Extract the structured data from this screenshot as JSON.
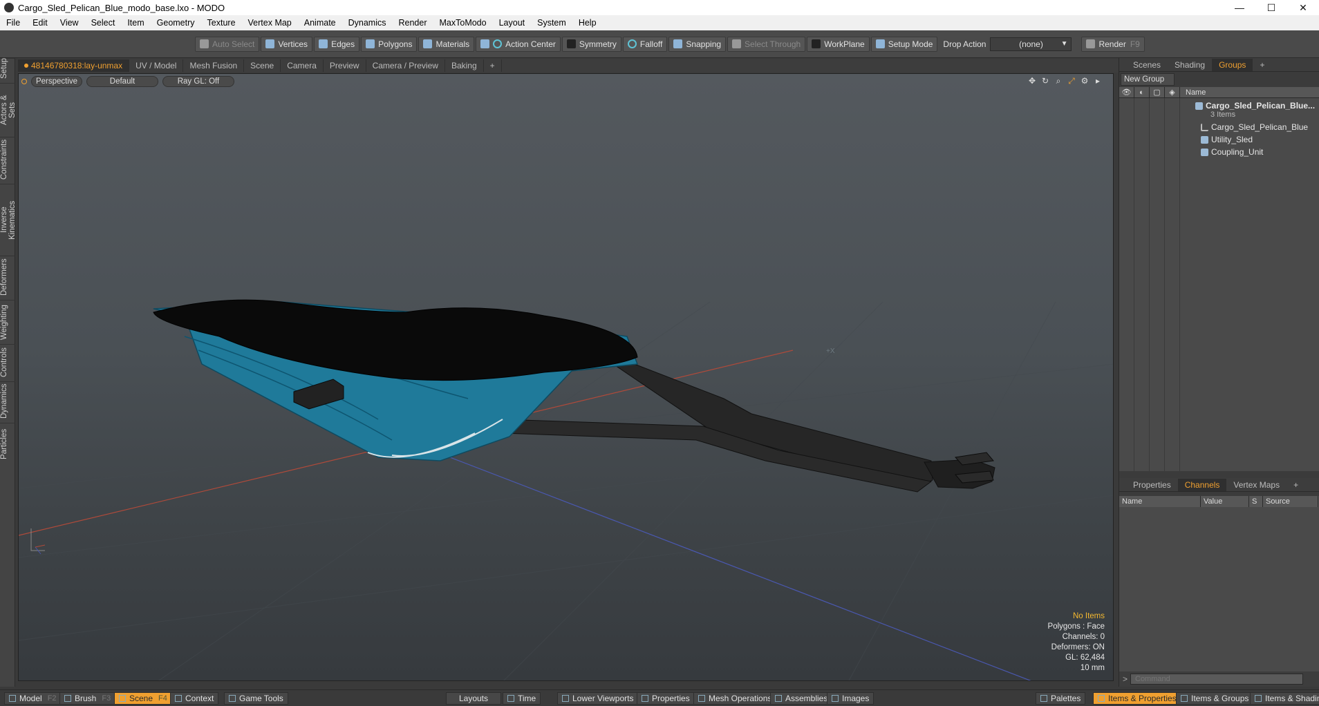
{
  "window": {
    "title": "Cargo_Sled_Pelican_Blue_modo_base.lxo - MODO",
    "minimize": "—",
    "maximize": "☐",
    "close": "✕"
  },
  "menu": [
    "File",
    "Edit",
    "View",
    "Select",
    "Item",
    "Geometry",
    "Texture",
    "Vertex Map",
    "Animate",
    "Dynamics",
    "Render",
    "MaxToModo",
    "Layout",
    "System",
    "Help"
  ],
  "toolbar": {
    "auto_select": "Auto Select",
    "vertices": "Vertices",
    "edges": "Edges",
    "polygons": "Polygons",
    "materials": "Materials",
    "action_center": "Action Center",
    "symmetry": "Symmetry",
    "falloff": "Falloff",
    "snapping": "Snapping",
    "select_through": "Select Through",
    "workplane": "WorkPlane",
    "setup_mode": "Setup Mode",
    "drop_action_label": "Drop Action",
    "drop_action_value": "(none)",
    "render": "Render",
    "render_key": "F9"
  },
  "left_rail": [
    "Setup",
    "Actors & Sets",
    "Constraints",
    "Inverse Kinematics",
    "Deformers",
    "Weighting",
    "Controls",
    "Dynamics",
    "Particles"
  ],
  "viewport_tabs": [
    "48146780318:lay-unmax",
    "UV / Model",
    "Mesh Fusion",
    "Scene",
    "Camera",
    "Preview",
    "Camera / Preview",
    "Baking",
    "+"
  ],
  "viewport": {
    "view": "Perspective",
    "style": "Default",
    "raygl": "Ray GL: Off",
    "axis_label": "+X",
    "stats": {
      "selection": "No Items",
      "polygons": "Polygons : Face",
      "channels": "Channels: 0",
      "deformers": "Deformers: ON",
      "gl": "GL: 62,484",
      "scale": "10 mm"
    },
    "colors": {
      "sled_blue": "#1f7a9a",
      "lid": "#0a0a0a",
      "frame": "#2a2a2a",
      "x_axis": "#b04a3a",
      "z_axis": "#4a58b0"
    }
  },
  "right_panel": {
    "top_tabs": [
      "Scenes",
      "Shading",
      "Groups",
      "+"
    ],
    "new_group": "New Group",
    "tree_header_name": "Name",
    "group_name": "Cargo_Sled_Pelican_Blue...",
    "group_count": "3 Items",
    "items": [
      "Cargo_Sled_Pelican_Blue",
      "Utility_Sled",
      "Coupling_Unit"
    ],
    "bottom_tabs": [
      "Properties",
      "Channels",
      "Vertex Maps",
      "+"
    ],
    "channel_cols": [
      "Name",
      "Value",
      "S",
      "Source"
    ],
    "command_placeholder": "Command"
  },
  "bottom_bar": {
    "model": "Model",
    "model_key": "F2",
    "brush": "Brush",
    "brush_key": "F3",
    "scene": "Scene",
    "scene_key": "F4",
    "context": "Context",
    "game_tools": "Game Tools",
    "layouts": "Layouts",
    "time": "Time",
    "lower_viewports": "Lower Viewports",
    "properties": "Properties",
    "mesh_operations": "Mesh Operations",
    "assemblies": "Assemblies",
    "images": "Images",
    "palettes": "Palettes",
    "items_properties": "Items & Properties",
    "items_groups": "Items & Groups",
    "items_shading": "Items & Shading"
  }
}
